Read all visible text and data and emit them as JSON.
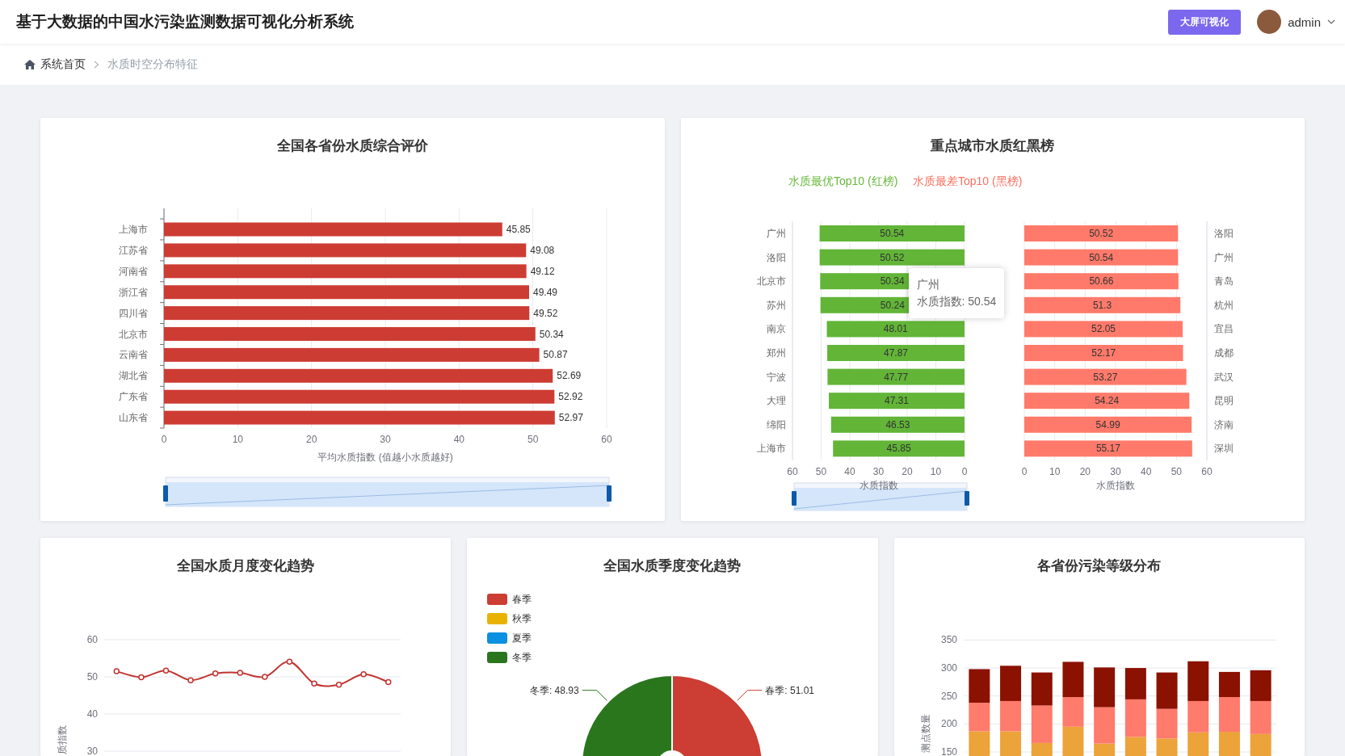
{
  "header": {
    "title": "基于大数据的中国水污染监测数据可视化分析系统",
    "button": "大屏可视化",
    "user": "admin"
  },
  "breadcrumb": [
    {
      "label": "系统首页",
      "kind": "home"
    },
    {
      "label": "水质时空分布特征",
      "kind": "current"
    }
  ],
  "province_card": {
    "title": "全国各省份水质综合评价",
    "zoom_slider": {
      "level": 1
    },
    "chart_data": {
      "type": "bar",
      "orientation": "horizontal",
      "grid": true,
      "xlabel": "平均水质指数 (值越小水质越好)",
      "categories": [
        "上海市",
        "江苏省",
        "河南省",
        "浙江省",
        "四川省",
        "北京市",
        "云南省",
        "湖北省",
        "广东省",
        "山东省"
      ],
      "xlim": [
        0,
        60
      ],
      "xticks": [
        0,
        10,
        20,
        30,
        40,
        50,
        60
      ],
      "data_labels": true,
      "series": [
        {
          "color": "#cd3c33",
          "values": [
            45.85,
            49.08,
            49.12,
            49.49,
            49.52,
            50.34,
            50.87,
            52.69,
            52.92,
            52.97
          ]
        }
      ]
    }
  },
  "city_card": {
    "title": "重点城市水质红黑榜",
    "legend": [
      {
        "label": "水质最优Top10 (红榜)",
        "color": "#67b83b"
      },
      {
        "label": "水质最差Top10 (黑榜)",
        "color": "#fa7060"
      }
    ],
    "best_chart": {
      "zoom_slider": {
        "level": 1
      },
      "chart_data": {
        "type": "bar",
        "orientation": "horizontal",
        "grid": true,
        "xlabel": "水质指数",
        "categories": [
          "广州",
          "洛阳",
          "北京市",
          "苏州",
          "南京",
          "郑州",
          "宁波",
          "大理",
          "绵阳",
          "上海市"
        ],
        "xlim": [
          60,
          0
        ],
        "xticks": [
          60,
          50,
          40,
          30,
          20,
          10,
          0
        ],
        "data_labels": true,
        "series": [
          {
            "color": "#62b537",
            "values": [
              50.54,
              50.52,
              50.34,
              50.24,
              48.01,
              47.87,
              47.77,
              47.31,
              46.53,
              45.85
            ]
          }
        ]
      }
    },
    "worst_chart": {
      "chart_data": {
        "type": "bar",
        "orientation": "horizontal",
        "grid": true,
        "xlabel": "水质指数",
        "categories": [
          "洛阳",
          "广州",
          "青岛",
          "杭州",
          "宜昌",
          "成都",
          "武汉",
          "昆明",
          "济南",
          "深圳"
        ],
        "xlim": [
          0,
          60
        ],
        "xticks": [
          0,
          10,
          20,
          30,
          40,
          50,
          60
        ],
        "data_labels": true,
        "series": [
          {
            "color": "#ff7a6a",
            "values": [
              50.52,
              50.54,
              50.66,
              51.3,
              52.05,
              52.17,
              53.27,
              54.24,
              54.99,
              55.17
            ]
          }
        ]
      }
    },
    "tooltip": {
      "title": "广州",
      "text": "水质指数: 50.54"
    }
  },
  "monthly_card": {
    "title": "全国水质月度变化趋势",
    "chart_data": {
      "type": "line",
      "grid": true,
      "ylabel": "质指数",
      "ylim": [
        30,
        60
      ],
      "yticks": [
        30,
        40,
        50,
        60
      ],
      "series": [
        {
          "color": "#c23531",
          "marker": true,
          "values": [
            51.5,
            49.9,
            51.7,
            49.1,
            50.9,
            51.1,
            50.0,
            54.1,
            48.2,
            47.9,
            50.7,
            48.6
          ]
        }
      ]
    }
  },
  "season_card": {
    "title": "全国水质季度变化趋势",
    "legend": [
      {
        "label": "春季",
        "color": "#cc3d33"
      },
      {
        "label": "秋季",
        "color": "#e9b200"
      },
      {
        "label": "夏季",
        "color": "#0a90e0"
      },
      {
        "label": "冬季",
        "color": "#2a761d"
      }
    ],
    "chart_data": {
      "type": "donut",
      "values": [
        51.01,
        48.93
      ],
      "colors": [
        "#cc3d33",
        "#2a761d"
      ],
      "value_labels": [
        "春季: 51.01",
        "冬季: 48.93"
      ]
    }
  },
  "level_card": {
    "title": "各省份污染等级分布",
    "chart_data": {
      "type": "bar",
      "orientation": "vertical",
      "stacked": true,
      "grid": true,
      "ylabel": "测点数量",
      "ylim": [
        0,
        350
      ],
      "yticks": [
        150,
        200,
        250,
        300,
        350
      ],
      "series": [
        {
          "color": "#eba33a",
          "values": [
            187,
            187,
            166,
            195,
            165,
            177,
            174,
            185,
            186,
            182
          ]
        },
        {
          "color": "#ff7b6b",
          "values": [
            51,
            54,
            67,
            53,
            65,
            67,
            53,
            56,
            62,
            59
          ]
        },
        {
          "color": "#8b1100",
          "values": [
            60,
            63,
            59,
            63,
            71,
            56,
            65,
            71,
            45,
            55
          ]
        }
      ]
    }
  }
}
